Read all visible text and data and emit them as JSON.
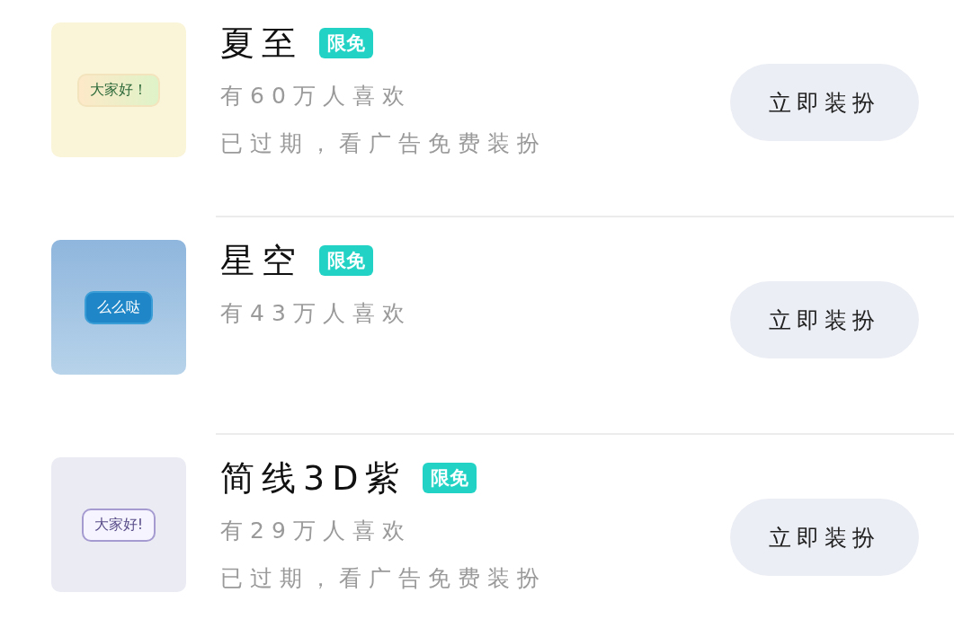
{
  "items": [
    {
      "thumbnail": {
        "kind": "summer",
        "preview_text": "大家好！"
      },
      "title": "夏至",
      "badge": "限免",
      "likes": "有60万人喜欢",
      "note": "已过期，看广告免费装扮",
      "button": "立即装扮"
    },
    {
      "thumbnail": {
        "kind": "starry",
        "preview_text": "么么哒"
      },
      "title": "星空",
      "badge": "限免",
      "likes": "有43万人喜欢",
      "button": "立即装扮"
    },
    {
      "thumbnail": {
        "kind": "line3d",
        "preview_text": "大家好!"
      },
      "title": "简线3D紫",
      "badge": "限免",
      "likes": "有29万人喜欢",
      "note": "已过期，看广告免费装扮",
      "button": "立即装扮"
    }
  ]
}
